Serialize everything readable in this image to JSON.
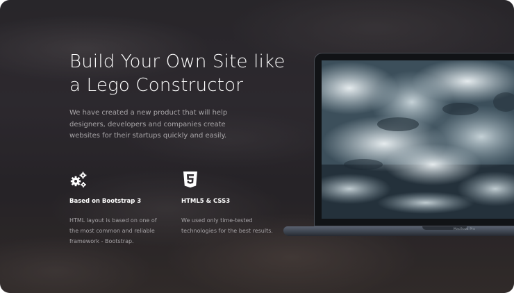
{
  "hero": {
    "title": "Build Your Own Site like a Lego Constructor",
    "text": "We have created a new product that will help designers, developers and companies create websites for their startups quickly and easily."
  },
  "features": [
    {
      "icon": "gears-icon",
      "title": "Based on Bootstrap 3",
      "text": "HTML layout is based on one of the most common and reliable framework - Bootstrap."
    },
    {
      "icon": "html5-icon",
      "title": "HTML5 & CSS3",
      "text": "We used only time-tested technologies for the best results."
    }
  ],
  "laptop": {
    "label": "MacBook Pro"
  },
  "colors": {
    "title": "#ffffff",
    "body_text": "#a8a5a8",
    "laptop_frame": "#111316"
  }
}
